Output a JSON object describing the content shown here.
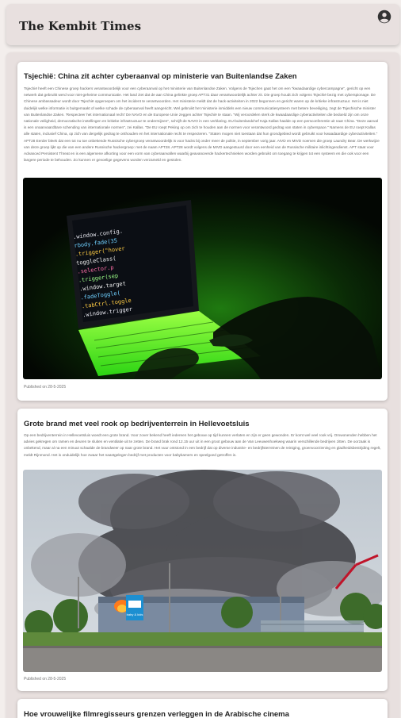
{
  "site": {
    "title": "The Kembit Times",
    "account_icon": "account-circle-icon"
  },
  "articles": [
    {
      "title": "Tsjechië: China zit achter cyberaanval op ministerie van Buitenlandse Zaken",
      "body": "Tsjechië heeft een Chinese groep hackers verantwoordelijk voor een cyberaanval op het ministerie van Buitenlandse Zaken. Volgens de Tsjechen gaat het om een \"kwaadaardige cybercampagne\", gericht op een netwerk dat gebruikt werd voor niet-geheime communicatie. Het land ziet dat de aan China gelinkte groep APT31 daar verantwoordelijk achter zit. Die groep houdt zich volgens Tsjechië bezig met cyberspionage. De Chinese ambassadeur wordt door Tsjechië opgeroepen om het incident te verantwoorden. Het ministerie meldt dat de hack-activiteiten in 2022 begonnen en gericht waren op de kritieke infrastructuur. Het is niet duidelijk welke informatie is buitgemaakt of welke schade de cyberaanval heeft aangericht. Wel gebruikt het ministerie inmiddels een nieuw communicatiesysteem met betere beveiliging, zegt de Tsjechische minister van Buitenlandse Zaken. 'Respecteer het internationaal recht' De NAVO en de Europese Unie zeggen achter Tsjechië te staan. \"Wij veroordelen sterk de kwaadaardige cyberactiviteiten die bedoeld zijn om onze nationale veiligheid, democratische instellingen en kritieke infrastructuur te ondermijnen\", schrijft de NAVO in een verklaring. EU-buitenlandchef Kaja Kallas haalde op een persconferentie uit naar China. \"Deze aanval is een onaanvaardbare schending van internationale normen\", zei Kallas. \"De EU roept Peking op om zich te houden aan de normen voor verantwoord gedrag van staten in cyberspace.\" Namens de EU roept Kallas alle staten, inclusief China, op zich van dergelijk gedrag te onthouden en het internationale recht te respecteren. \"Staten mogen niet toestaan dat hun grondgebied wordt gebruikt voor kwaadaardige cyberactiviteiten.\" APT28 Eerder bleek dat een tot nu toe onbekende Russische cybergroep verantwoordelijk is voor hacks bij onder meer de politie, in september vorig jaar. AIVD en MIVD noemen die groep Laundry Bear. De werkwijze van deze groep lijkt op die van een andere Russische hackergroep: met de naam APT28. APT28 wordt volgens de MIVD aangestuurd door een eenheid van de Russische militaire inlichtingendienst. APT staat voor Advanced Persistent Threat en is een algemene afkorting voor een vorm van cyberaanvallen waarbij geavanceerde hackertechnieken worden gebruikt om toegang te krijgen tot een systeem en die ook voor een langere periode te behouden. Zo kunnen er gevoelige gegevens worden verzameld en gestolen.",
      "date": "Published on 28-5-2025",
      "image_icon": "laptop-hacker-image"
    },
    {
      "title": "Grote brand met veel rook op bedrijventerrein in Hellevoetsluis",
      "body": "Op een bedrijventerrein in Hellevoetsluis woedt een grote brand. Voor zover bekend heeft iedereen het gebouw op tijd kunnen verlaten en zijn er geen gewonden. Er komt wel veel rook vrij. Omwonenden hebben het advies gekregen om ramen en deuren te sluiten en ventilatie uit te zetten. De brand brak rond 12.15 uur uit in een groot gebouw aan de Van Leeuwenhoekweg waarin verschillende bedrijven zitten. De oorzaak is onbekend, maar al na een minuut schaalde de brandweer op naar grote brand. Het vuur ontstond in een bedrijf dat op diverse industrie- en bedrijfsterreinen de reiniging, groenvoorziening en gladheidsbestrijding regelt, meldt Rijnmond. Het is onduidelijk hoe zwaar het naastgelegen bedrijf met producten voor babykamers en speelgoed getroffen is.",
      "date": "Published on 28-5-2025",
      "image_icon": "fire-smoke-image",
      "image_sign": "baby & kids"
    },
    {
      "title": "Hoe vrouwelijke filmregisseurs grenzen verleggen in de Arabische cinema"
    }
  ]
}
